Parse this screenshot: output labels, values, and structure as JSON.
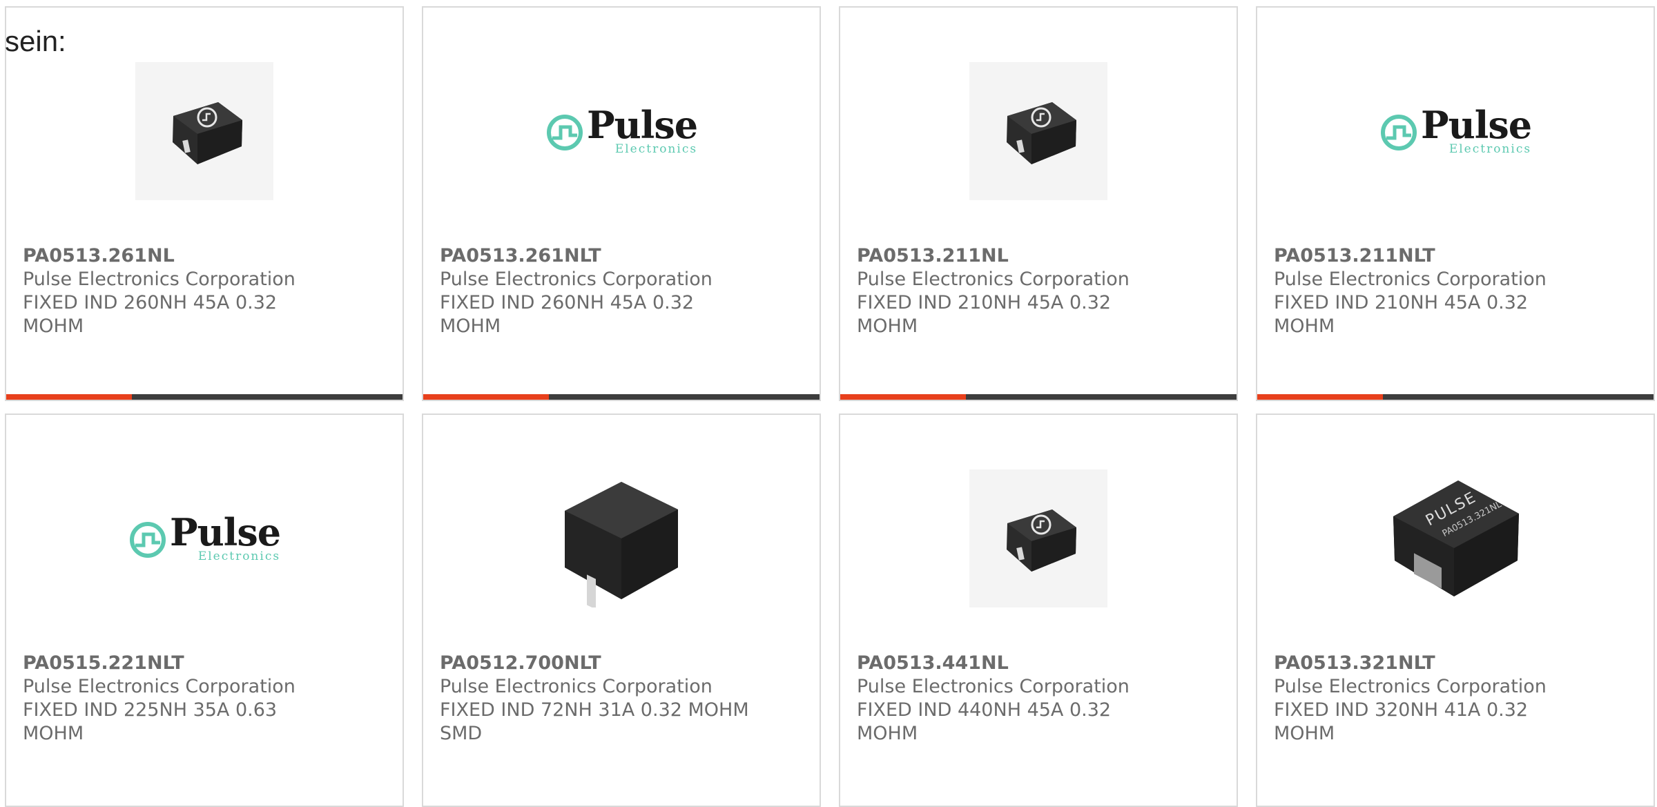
{
  "intro_text": "sein:",
  "colors": {
    "accent": "#e8401c",
    "bar": "#3d3d3d",
    "teal": "#5cc9b0"
  },
  "logo": {
    "main": "Pulse",
    "sub": "Electronics"
  },
  "products": [
    {
      "part": "PA0513.261NL",
      "manufacturer": "Pulse Electronics Corporation",
      "desc_1": "FIXED IND 260NH 45A 0.32",
      "desc_2": "MOHM",
      "image": "inductor-small-icon"
    },
    {
      "part": "PA0513.261NLT",
      "manufacturer": "Pulse Electronics Corporation",
      "desc_1": "FIXED IND 260NH 45A 0.32",
      "desc_2": "MOHM",
      "image": "pulse-logo"
    },
    {
      "part": "PA0513.211NL",
      "manufacturer": "Pulse Electronics Corporation",
      "desc_1": "FIXED IND 210NH 45A 0.32",
      "desc_2": "MOHM",
      "image": "inductor-small-icon"
    },
    {
      "part": "PA0513.211NLT",
      "manufacturer": "Pulse Electronics Corporation",
      "desc_1": "FIXED IND 210NH 45A 0.32",
      "desc_2": "MOHM",
      "image": "pulse-logo"
    },
    {
      "part": "PA0515.221NLT",
      "manufacturer": "Pulse Electronics Corporation",
      "desc_1": "FIXED IND 225NH 35A 0.63",
      "desc_2": "MOHM",
      "image": "pulse-logo"
    },
    {
      "part": "PA0512.700NLT",
      "manufacturer": "Pulse Electronics Corporation",
      "desc_1": "FIXED IND 72NH 31A 0.32 MOHM",
      "desc_2": "SMD",
      "image": "inductor-large-icon"
    },
    {
      "part": "PA0513.441NL",
      "manufacturer": "Pulse Electronics Corporation",
      "desc_1": "FIXED IND 440NH 45A 0.32",
      "desc_2": "MOHM",
      "image": "inductor-small-icon"
    },
    {
      "part": "PA0513.321NLT",
      "manufacturer": "Pulse Electronics Corporation",
      "desc_1": "FIXED IND 320NH 41A 0.32",
      "desc_2": "MOHM",
      "image": "inductor-printed-icon",
      "image_text_1": "PULSE",
      "image_text_2": "PA0513.321NL"
    }
  ]
}
